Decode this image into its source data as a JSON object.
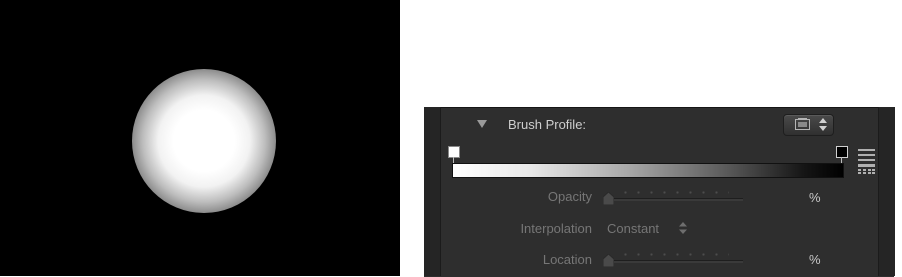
{
  "preview": {
    "background": "#000000",
    "brush_color": "#ffffff"
  },
  "panel": {
    "section": {
      "title": "Brush Profile:",
      "expanded": true,
      "preset_icon": "preset-folder-icon"
    },
    "gradient": {
      "start_stop_color": "#ffffff",
      "end_stop_color": "#000000",
      "from": "#ffffff",
      "to": "#000000"
    },
    "parameters": {
      "opacity": {
        "label": "Opacity",
        "unit": "%",
        "value_fraction": 0.0
      },
      "interpolation": {
        "label": "Interpolation",
        "value": "Constant"
      },
      "location": {
        "label": "Location",
        "unit": "%",
        "value_fraction": 0.0
      }
    },
    "icons": {
      "list": "list-view-icon",
      "grid": "grid-view-icon"
    }
  }
}
